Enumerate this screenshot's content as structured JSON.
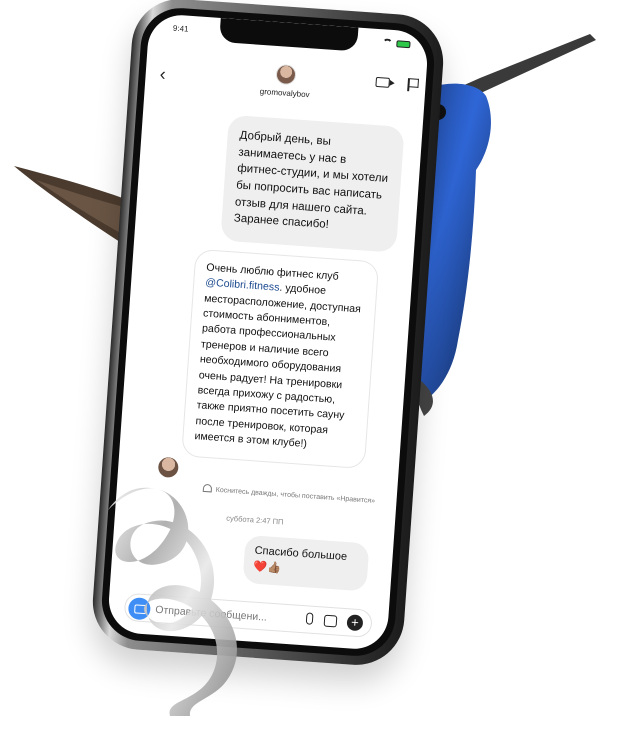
{
  "status_bar": {
    "time": "9:41"
  },
  "header": {
    "username": "gromovalybov"
  },
  "messages": {
    "outgoing_1": "Добрый день, вы занимаетесь у нас в фитнес-студии, и мы хотели бы попросить вас написать отзыв для нашего сайта. Заранее спасибо!",
    "incoming_1_before": "Очень люблю фитнес клуб",
    "incoming_1_mention": "@Colibri.fitness",
    "incoming_1_after": ".  удобное месторасположение, доступная стоимость абонниментов, работа профессиональных тренеров и наличие всего необходимого оборудования очень радует! На тренировки всегда прихожу с радостью, также приятно посетить сауну после тренировок, которая имеется в этом клубе!)",
    "like_hint": "Коснитесь дважды, чтобы поставить «Нравится»",
    "date": "суббота 2:47 ПП",
    "outgoing_2": "Спасибо большое",
    "outgoing_2_emoji": "❤️👍🏽"
  },
  "composer": {
    "placeholder": "Отправьте сообщени..."
  },
  "colors": {
    "accent_blue": "#3e8ef5",
    "bubble_gray": "#efefef",
    "mention": "#1c4a8f"
  }
}
